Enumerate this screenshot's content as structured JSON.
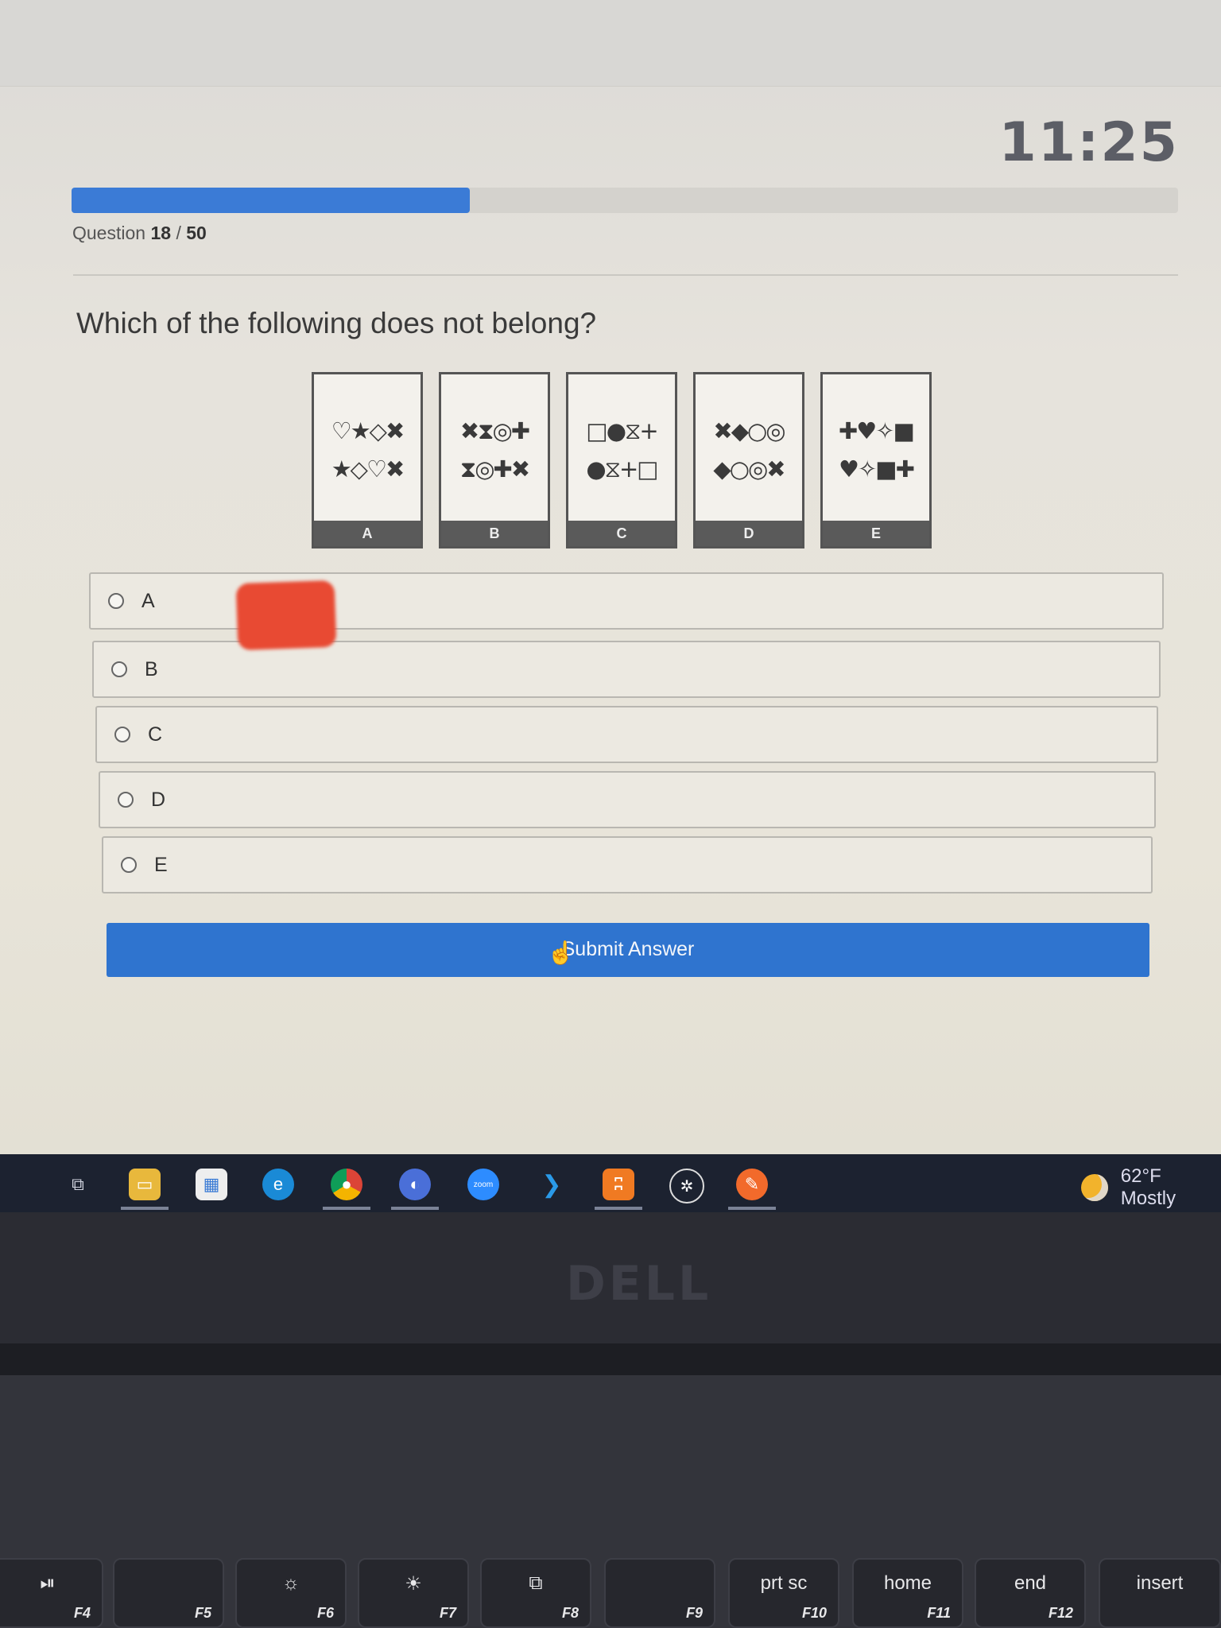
{
  "timer": "11:25",
  "progress": {
    "current": 18,
    "total": 50,
    "fraction": 0.36,
    "prefix": "Question",
    "current_label": "18",
    "sep": "/",
    "total_label": "50"
  },
  "question": "Which of the following does not belong?",
  "panels": [
    {
      "label": "A",
      "row1": "♡★◇✖",
      "row2": "★◇♡✖"
    },
    {
      "label": "B",
      "row1": "✖⧗◎✚",
      "row2": "⧗◎✚✖"
    },
    {
      "label": "C",
      "row1": "□●⧖+",
      "row2": "●⧖+□"
    },
    {
      "label": "D",
      "row1": "✖◆○◎",
      "row2": "◆○◎✖"
    },
    {
      "label": "E",
      "row1": "✚♥✧■",
      "row2": "♥✧■✚"
    }
  ],
  "options": [
    "A",
    "B",
    "C",
    "D",
    "E"
  ],
  "submit_label": "Submit Answer",
  "taskbar": {
    "apps": [
      "task-view",
      "file-explorer",
      "store",
      "edge",
      "chrome",
      "app",
      "zoom",
      "vscode",
      "xampp",
      "chatgpt",
      "app-orange"
    ],
    "zoom_label": "zoom",
    "weather": "62°F Mostly"
  },
  "laptop": {
    "logo": "DELL",
    "keys": [
      {
        "top": "⏯",
        "fn": "F4"
      },
      {
        "top": "",
        "fn": "F5"
      },
      {
        "top": "☼",
        "fn": "F6"
      },
      {
        "top": "☀",
        "fn": "F7"
      },
      {
        "top": "⧉",
        "fn": "F8"
      },
      {
        "top": "",
        "fn": "F9"
      },
      {
        "top": "prt sc",
        "fn": "F10"
      },
      {
        "top": "home",
        "fn": "F11"
      },
      {
        "top": "end",
        "fn": "F12"
      },
      {
        "top": "insert",
        "fn": ""
      }
    ]
  },
  "colors": {
    "accent": "#2f74cf",
    "progress": "#3b7bd6",
    "taskbar": "#1c2230"
  }
}
